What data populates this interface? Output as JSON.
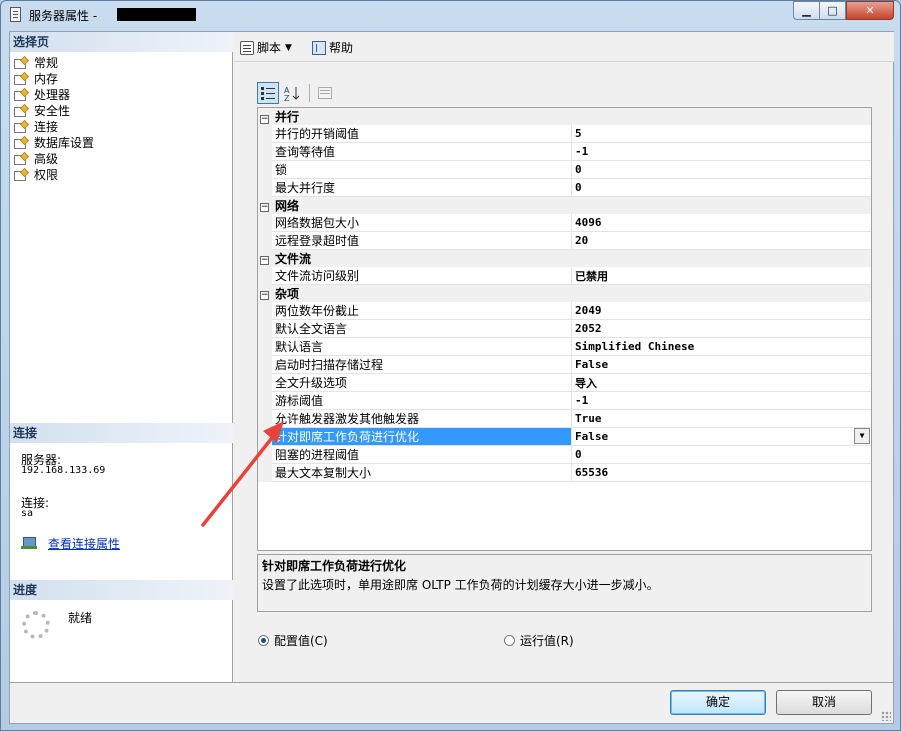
{
  "window": {
    "title": "服务器属性 -",
    "buttons": {
      "minimize": "▁",
      "maximize": "□",
      "close": "✕"
    }
  },
  "left": {
    "select_header": "选择页",
    "pages": [
      "常规",
      "内存",
      "处理器",
      "安全性",
      "连接",
      "数据库设置",
      "高级",
      "权限"
    ],
    "connection": {
      "header": "连接",
      "server_label": "服务器:",
      "server_value": "192.168.133.69",
      "user_label": "连接:",
      "user_value": "sa",
      "link": "查看连接属性"
    },
    "progress": {
      "header": "进度",
      "status": "就绪"
    }
  },
  "toolbar": {
    "script_label": "脚本",
    "script_arrow": "▼",
    "help_label": "帮助"
  },
  "grid": {
    "categories": [
      {
        "name": "并行",
        "toggle": "−",
        "rows": [
          {
            "name": "并行的开销阈值",
            "value": "5"
          },
          {
            "name": "查询等待值",
            "value": "-1"
          },
          {
            "name": "锁",
            "value": "0"
          },
          {
            "name": "最大并行度",
            "value": "0"
          }
        ]
      },
      {
        "name": "网络",
        "toggle": "−",
        "rows": [
          {
            "name": "网络数据包大小",
            "value": "4096"
          },
          {
            "name": "远程登录超时值",
            "value": "20"
          }
        ]
      },
      {
        "name": "文件流",
        "toggle": "−",
        "rows": [
          {
            "name": "文件流访问级别",
            "value": "已禁用"
          }
        ]
      },
      {
        "name": "杂项",
        "toggle": "−",
        "rows": [
          {
            "name": "两位数年份截止",
            "value": "2049"
          },
          {
            "name": "默认全文语言",
            "value": "2052"
          },
          {
            "name": "默认语言",
            "value": "Simplified Chinese"
          },
          {
            "name": "启动时扫描存储过程",
            "value": "False"
          },
          {
            "name": "全文升级选项",
            "value": "导入"
          },
          {
            "name": "游标阈值",
            "value": "-1"
          },
          {
            "name": "允许触发器激发其他触发器",
            "value": "True"
          },
          {
            "name": "针对即席工作负荷进行优化",
            "value": "False",
            "selected": true
          },
          {
            "name": "阻塞的进程阈值",
            "value": "0"
          },
          {
            "name": "最大文本复制大小",
            "value": "65536"
          }
        ]
      }
    ]
  },
  "description": {
    "title": "针对即席工作负荷进行优化",
    "text": "设置了此选项时，单用途即席 OLTP 工作负荷的计划缓存大小进一步减小。"
  },
  "options": {
    "config_value": "配置值(C)",
    "running_value": "运行值(R)",
    "selected": "config"
  },
  "buttons": {
    "ok": "确定",
    "cancel": "取消"
  },
  "colors": {
    "selection": "#3399ff",
    "annotation_arrow": "#e8423a"
  }
}
